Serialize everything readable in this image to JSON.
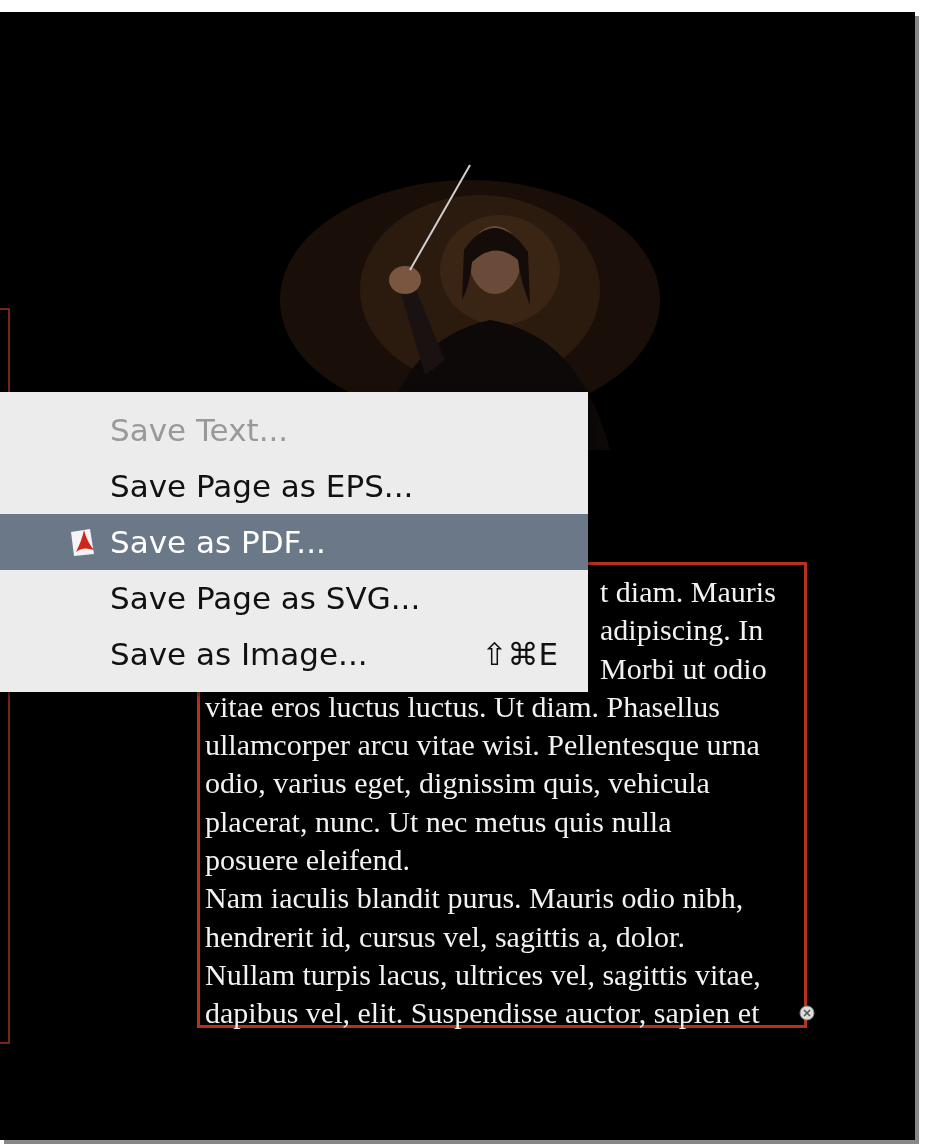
{
  "text_frame": {
    "lines": [
      {
        "text": "t diam. Mauris",
        "kind": "partial"
      },
      {
        "text": "adipiscing. In",
        "kind": "partial"
      },
      {
        "text": "Morbi ut odio",
        "kind": "partial"
      },
      {
        "text": "vitae eros luctus luctus. Ut diam. Phasellus",
        "kind": "full"
      },
      {
        "text": "ullamcorper arcu vitae wisi. Pellentesque urna",
        "kind": "full"
      },
      {
        "text": "odio, varius eget, dignissim quis, vehicula",
        "kind": "full"
      },
      {
        "text": "placerat, nunc. Ut nec metus quis nulla",
        "kind": "full"
      },
      {
        "text": "posuere eleifend.",
        "kind": "full"
      },
      {
        "text": "Nam iaculis blandit purus. Mauris odio nibh,",
        "kind": "full"
      },
      {
        "text": "hendrerit id, cursus vel, sagittis a, dolor.",
        "kind": "full"
      },
      {
        "text": "Nullam turpis lacus, ultrices vel, sagittis vitae,",
        "kind": "full"
      },
      {
        "text": "dapibus vel, elit. Suspendisse auctor, sapien et",
        "kind": "full"
      }
    ]
  },
  "context_menu": {
    "items": [
      {
        "label": "Save Text...",
        "disabled": true,
        "selected": false,
        "kind": "plain"
      },
      {
        "label": "Save Page as EPS...",
        "disabled": false,
        "selected": false,
        "kind": "plain"
      },
      {
        "label": "Save as PDF...",
        "disabled": false,
        "selected": true,
        "kind": "document"
      },
      {
        "label": "Save Page as SVG...",
        "disabled": false,
        "selected": false,
        "kind": "plain"
      },
      {
        "label": "Save as Image...",
        "disabled": false,
        "selected": false,
        "kind": "plain",
        "shortcut": "⇧⌘E"
      }
    ]
  }
}
